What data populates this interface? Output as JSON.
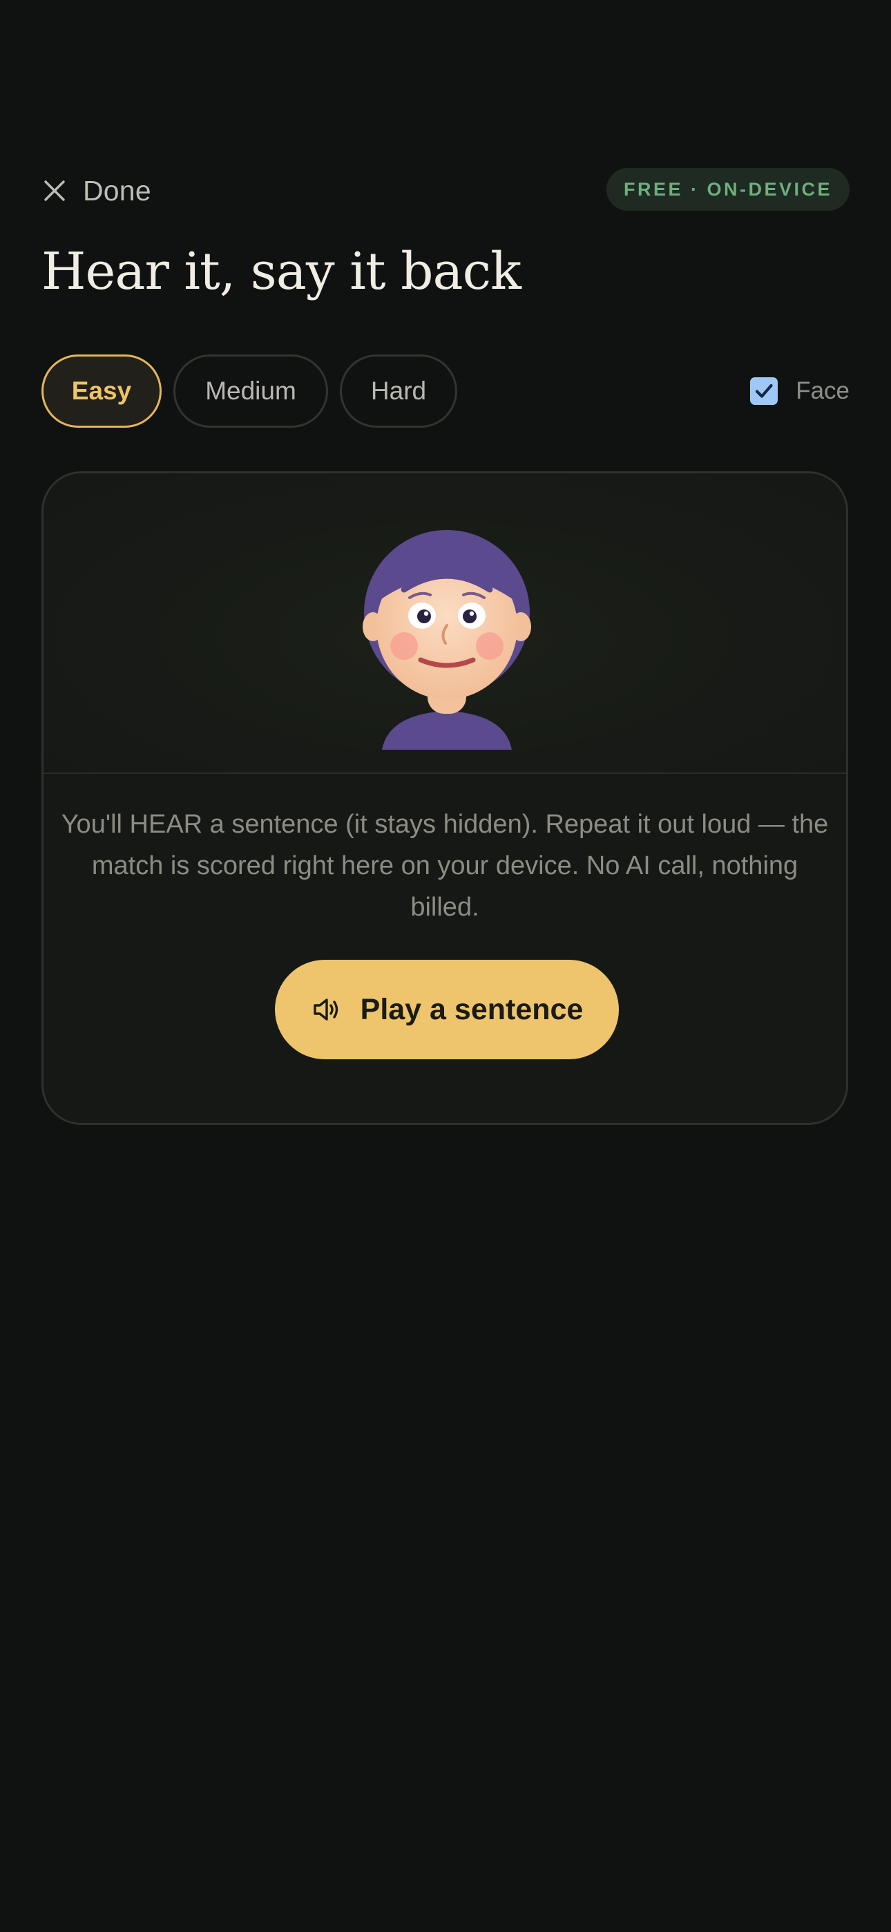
{
  "header": {
    "done_label": "Done",
    "badge": "FREE · ON-DEVICE"
  },
  "title": "Hear it, say it back",
  "levels": {
    "options": [
      "Easy",
      "Medium",
      "Hard"
    ],
    "selected": "Easy"
  },
  "face_toggle": {
    "label": "Face",
    "checked": true
  },
  "card": {
    "instructions": "You'll HEAR a sentence (it stays hidden). Repeat it out loud — the match is scored right here on your device. No AI call, nothing billed.",
    "play_label": "Play a sentence"
  },
  "colors": {
    "background": "#101211",
    "accent": "#eec56c",
    "badge_text": "#6fae7e",
    "avatar_hair": "#5b4a8e",
    "checkbox": "#9fc8f5"
  },
  "icons": {
    "done": "close-icon",
    "play": "speaker-icon",
    "face": "checkmark-icon"
  }
}
